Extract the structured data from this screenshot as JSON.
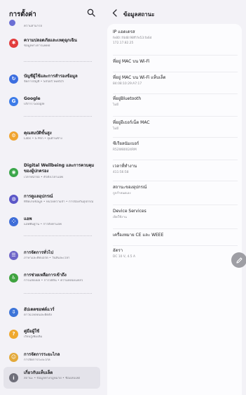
{
  "left_pane": {
    "title": "การตั้งค่า",
    "partial_top_sub": "ความสามารถ",
    "items": [
      {
        "title": "ความปลอดภัยและเหตุฉุกเฉิน",
        "sub": "ข้อมูลทางการแพทย์",
        "color": "#e23d3d",
        "glyph": "✱"
      },
      {
        "title": "บัญชีผู้ใช้และการสำรองข้อมูล",
        "sub": "จัดการบัญชี  •  Smart Switch",
        "color": "#3d6fe0",
        "glyph": "↻"
      },
      {
        "title": "Google",
        "sub": "บริการ Google",
        "color": "#3c7be8",
        "glyph": "G"
      },
      {
        "title": "คุณสมบัติขั้นสูง",
        "sub": "Labs  •  S Pen  •  ปุ่มด้านข้าง",
        "color": "#f0a430",
        "glyph": "⚙"
      },
      {
        "title": "Digital Wellbeing และการควบคุมของผู้ปกครอง",
        "sub": "เวลาหน้าจอ  •  ตัวตั้งเวลาแอพ",
        "color": "#3aa64a",
        "glyph": "◉"
      },
      {
        "title": "การดูแลอุปกรณ์",
        "sub": "ที่จัดเก็บข้อมูล  •  หน่วยความจำ  •  การป้องกันอุปกรณ์",
        "color": "#5b57c8",
        "glyph": "◍"
      },
      {
        "title": "แอพ",
        "sub": "แอพพื้นฐาน  •  การตั้งค่าแอพ",
        "color": "#3f6ed8",
        "glyph": "⁘"
      },
      {
        "title": "การจัดการทั่วไป",
        "sub": "ภาษาและคีย์บอร์ด  •  วันที่และเวลา",
        "color": "#6e65c8",
        "glyph": "☰"
      },
      {
        "title": "การช่วยเหลือการเข้าถึง",
        "sub": "การแสดงผล  •  การได้ยิน  •  ความคล่องแคล่ว",
        "color": "#3fa33f",
        "glyph": "♿"
      },
      {
        "title": "อัปเดตซอฟต์แวร์",
        "sub": "ดาวน์โหลดและติดตั้ง",
        "color": "#3c74d8",
        "glyph": "⇩"
      },
      {
        "title": "คู่มือผู้ใช้",
        "sub": "เรียนรู้เพิ่มเติม",
        "color": "#efa82e",
        "glyph": "?"
      },
      {
        "title": "การจัดการระยะไกล",
        "sub": "การจัดการระยะไกล",
        "color": "#e3a93a",
        "glyph": "☺"
      },
      {
        "title": "เกี่ยวกับแท็บเล็ต",
        "sub": "สถานะ  •  ข้อมูลทางกฎหมาย  •  ชื่อแท็บเล็ต",
        "color": "#6f6f7a",
        "glyph": "i"
      }
    ]
  },
  "right_pane": {
    "title": "ข้อมูลสถานะ",
    "rows": [
      {
        "label": "IP แอดเดรส",
        "values": [
          "fe80::f4d8:98ff:fe53:fa6d",
          "172.17.82.25"
        ]
      },
      {
        "label": "ที่อยู่ MAC บน Wi-Fi",
        "values": []
      },
      {
        "label": "ที่อยู่ MAC บน Wi-Fi แท็บเล็ต",
        "values": [
          "84:08:10:29:A7:17"
        ]
      },
      {
        "label": "ที่อยู่Bluetooth",
        "values": [
          "ไม่มี"
        ]
      },
      {
        "label": "ที่อยู่อีเธอร์เน็ต MAC",
        "values": [
          "ไม่มี"
        ]
      },
      {
        "label": "ซีเรียลนัมเบอร์",
        "values": [
          "R52W80024RM"
        ]
      },
      {
        "label": "เวลาที่ทำงาน",
        "values": [
          "411:56:58"
        ]
      },
      {
        "label": "สถานะของอุปกรณ์",
        "values": [
          "ถูกกำหนดเอง"
        ]
      },
      {
        "label": "Device Services",
        "values": [
          "เปิดใช้งาน"
        ]
      },
      {
        "label": "เครื่องหมาย CE และ WEEE",
        "values": []
      },
      {
        "label": "อัตรา",
        "values": [
          "DC 10 V, 4.5 A"
        ]
      }
    ]
  }
}
